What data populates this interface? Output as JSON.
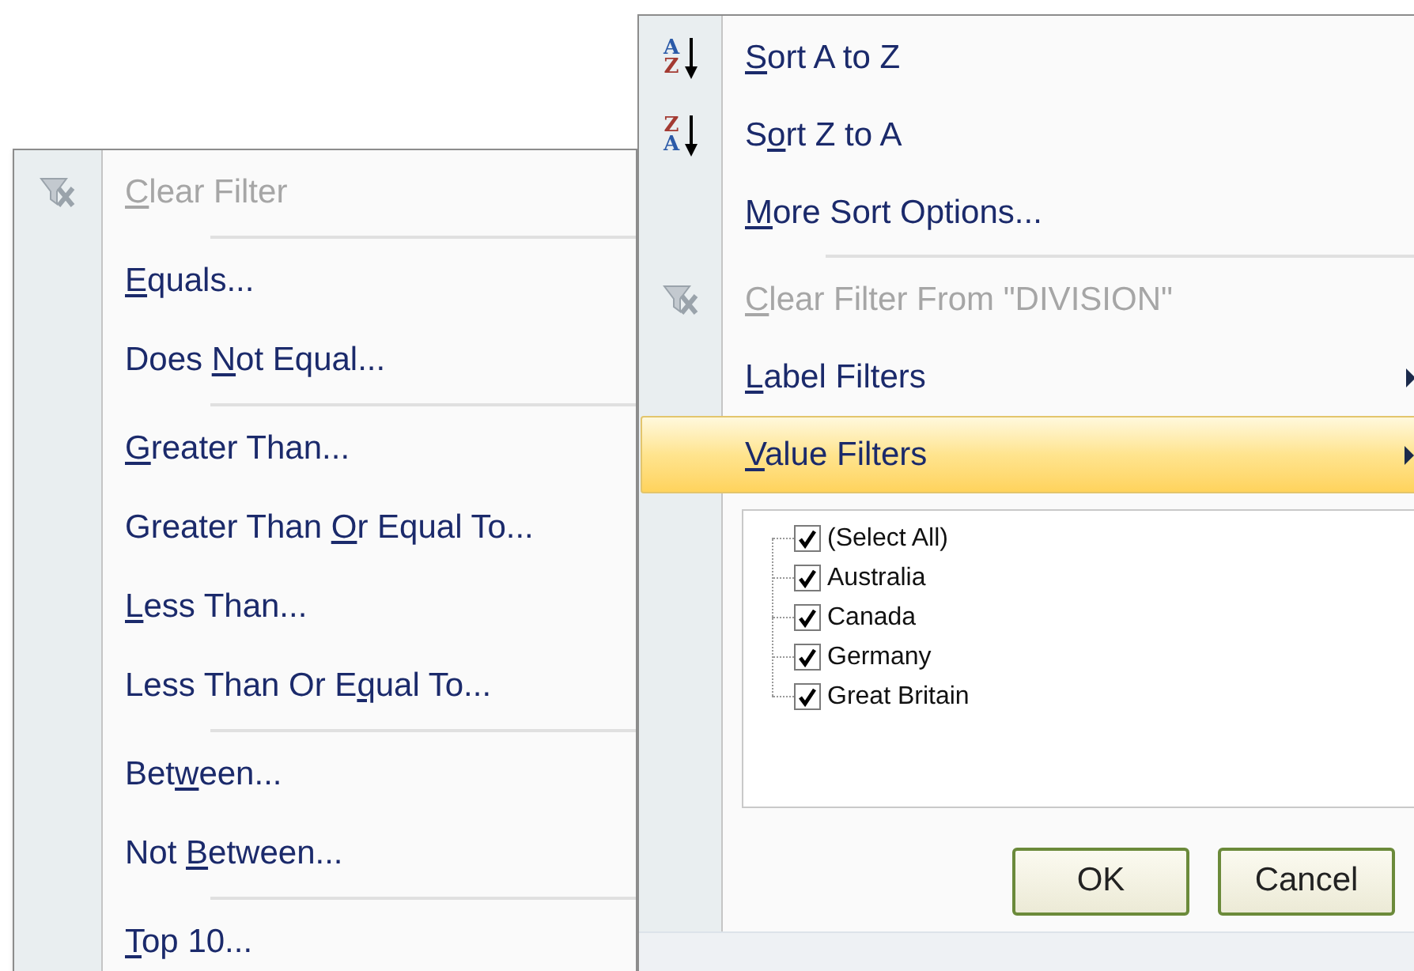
{
  "value_filters_menu": {
    "items": [
      {
        "kind": "item",
        "access_key": "C",
        "label_end": "lear Filter",
        "icon": {
          "kind": "clear-filter"
        },
        "disabled": true
      },
      {
        "kind": "separator"
      },
      {
        "kind": "item",
        "access_key": "E",
        "label_end": "quals...",
        "disabled": false
      },
      {
        "kind": "item",
        "label_start": "Does ",
        "access_key": "N",
        "label_end": "ot Equal...",
        "disabled": false
      },
      {
        "kind": "separator"
      },
      {
        "kind": "item",
        "access_key": "G",
        "label_end": "reater Than...",
        "disabled": false
      },
      {
        "kind": "item",
        "label_start": "Greater Than ",
        "access_key": "O",
        "label_end": "r Equal To...",
        "disabled": false
      },
      {
        "kind": "item",
        "access_key": "L",
        "label_end": "ess Than...",
        "disabled": false
      },
      {
        "kind": "item",
        "label_start": "Less Than Or E",
        "access_key": "q",
        "label_end": "ual To...",
        "disabled": false
      },
      {
        "kind": "separator"
      },
      {
        "kind": "item",
        "label_start": "Bet",
        "access_key": "w",
        "label_end": "een...",
        "disabled": false
      },
      {
        "kind": "item",
        "label_start": "Not ",
        "access_key": "B",
        "label_end": "etween...",
        "disabled": false
      },
      {
        "kind": "separator"
      },
      {
        "kind": "item",
        "access_key": "T",
        "label_end": "op 10...",
        "disabled": false
      }
    ]
  },
  "filter_menu": {
    "items": [
      {
        "kind": "item",
        "access_key": "S",
        "label_end": "ort A to Z",
        "icon": {
          "kind": "sort",
          "top": "A",
          "bottom": "Z"
        },
        "disabled": false,
        "selected": false
      },
      {
        "kind": "item",
        "label_start": "S",
        "access_key": "o",
        "label_end": "rt Z to A",
        "icon": {
          "kind": "sort",
          "top": "Z",
          "bottom": "A"
        },
        "disabled": false,
        "selected": false
      },
      {
        "kind": "item",
        "access_key": "M",
        "label_end": "ore Sort Options...",
        "disabled": false,
        "selected": false
      },
      {
        "kind": "separator"
      },
      {
        "kind": "item",
        "access_key": "C",
        "label_end": "lear Filter From \"DIVISION\"",
        "icon": {
          "kind": "clear-filter"
        },
        "disabled": true,
        "selected": false
      },
      {
        "kind": "item",
        "access_key": "L",
        "label_end": "abel Filters",
        "disabled": false,
        "selected": false,
        "submenu": true
      },
      {
        "kind": "item",
        "access_key": "V",
        "label_end": "alue Filters",
        "disabled": false,
        "selected": true,
        "submenu": true
      }
    ],
    "checklist": [
      {
        "label": "(Select All)",
        "checked": true
      },
      {
        "label": "Australia",
        "checked": true
      },
      {
        "label": "Canada",
        "checked": true
      },
      {
        "label": "Germany",
        "checked": true
      },
      {
        "label": "Great Britain",
        "checked": true
      }
    ],
    "buttons": [
      "OK",
      "Cancel"
    ]
  }
}
